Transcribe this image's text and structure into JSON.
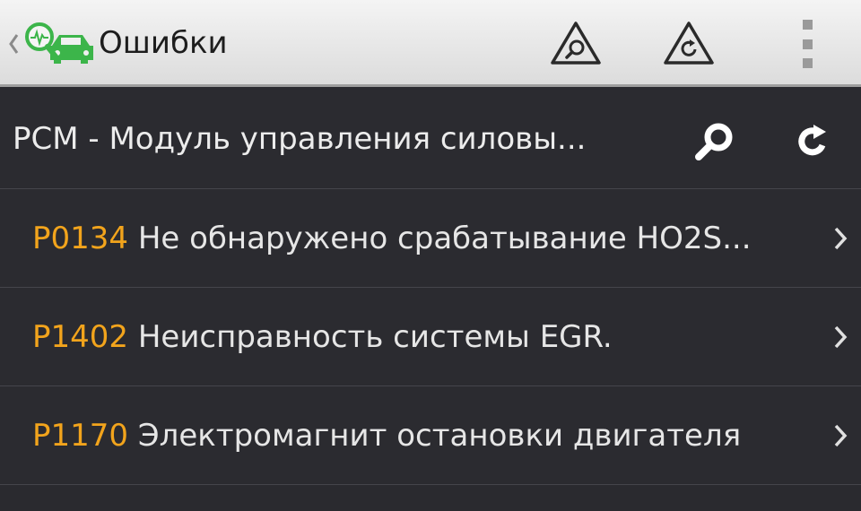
{
  "action_bar": {
    "title": "Ошибки",
    "icons": {
      "back": "chevron-left-icon",
      "logo": "car-diagnostics-logo-icon",
      "warning_search": "warning-search-icon",
      "warning_refresh": "warning-refresh-icon",
      "overflow": "overflow-menu-icon"
    }
  },
  "module": {
    "title": "PCM - Модуль управления силовы...",
    "search_icon": "search-icon",
    "refresh_icon": "refresh-icon"
  },
  "dtc_list": [
    {
      "code": "P0134",
      "description": "Не обнаружено срабатывание HO2S..."
    },
    {
      "code": "P1402",
      "description": "Неисправность системы EGR."
    },
    {
      "code": "P1170",
      "description": "Электромагнит остановки двигателя"
    }
  ],
  "colors": {
    "accent_code": "#f2a41c",
    "logo_green": "#3cb54a",
    "background": "#2a2a2f",
    "action_bar": "#e8e8e8"
  }
}
